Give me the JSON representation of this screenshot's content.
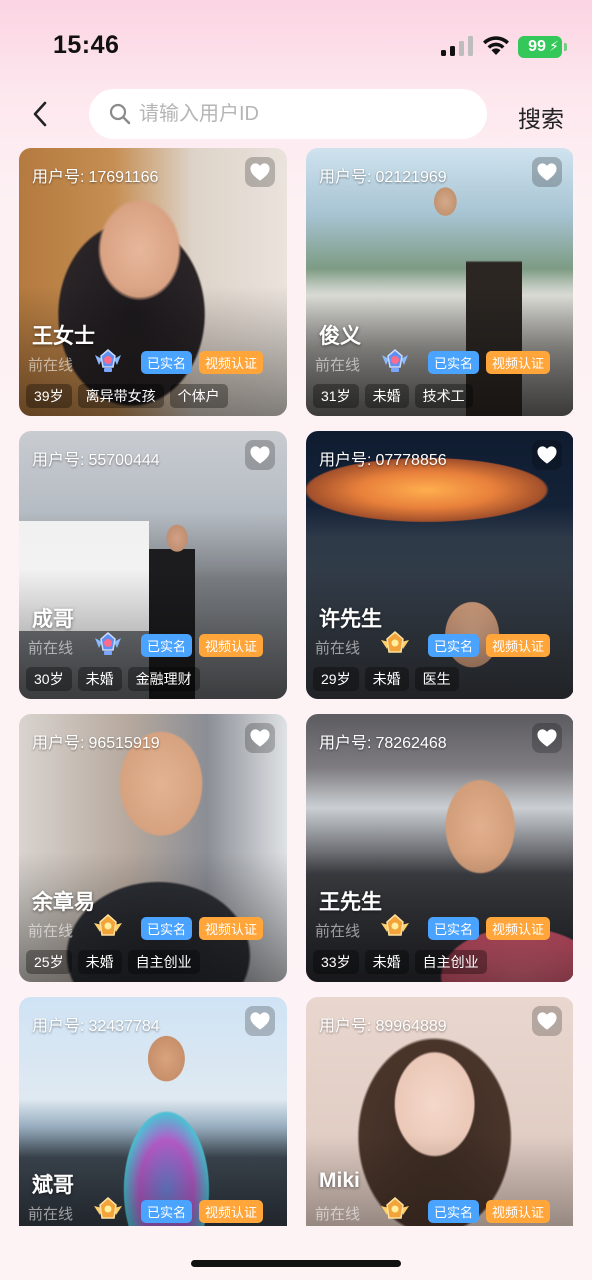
{
  "status_bar": {
    "time": "15:46",
    "battery": "99"
  },
  "header": {
    "search_placeholder": "请输入用户ID",
    "search_button": "搜索"
  },
  "labels": {
    "uid_prefix": "用户号:",
    "online": "前在线",
    "verified_name": "已实名",
    "verified_video": "视频认证"
  },
  "users": [
    {
      "uid": "17691166",
      "name": "王女士",
      "age": "39岁",
      "marital": "离异带女孩",
      "job": "个体户",
      "medal": "blue",
      "photo": "warm-room"
    },
    {
      "uid": "02121969",
      "name": "俊义",
      "age": "31岁",
      "marital": "未婚",
      "job": "技术工",
      "medal": "blue",
      "photo": "street-day"
    },
    {
      "uid": "55700444",
      "name": "成哥",
      "age": "30岁",
      "marital": "未婚",
      "job": "金融理财",
      "medal": "blue",
      "photo": "street-grey"
    },
    {
      "uid": "07778856",
      "name": "许先生",
      "age": "29岁",
      "marital": "未婚",
      "job": "医生",
      "medal": "gold",
      "photo": "stadium-night"
    },
    {
      "uid": "96515919",
      "name": "余章易",
      "age": "25岁",
      "marital": "未婚",
      "job": "自主创业",
      "medal": "gold",
      "photo": "selfie-jacket"
    },
    {
      "uid": "78262468",
      "name": "王先生",
      "age": "33岁",
      "marital": "未婚",
      "job": "自主创业",
      "medal": "gold",
      "photo": "car-interior"
    },
    {
      "uid": "32437784",
      "name": "斌哥",
      "age": "",
      "marital": "",
      "job": "",
      "medal": "gold",
      "photo": "waterfront"
    },
    {
      "uid": "89964889",
      "name": "Miki",
      "age": "",
      "marital": "",
      "job": "",
      "medal": "gold",
      "photo": "girl-glasses"
    }
  ],
  "colors": {
    "verified_name": "#4aa3ff",
    "verified_video": "#ffa53a",
    "battery": "#34c759"
  }
}
